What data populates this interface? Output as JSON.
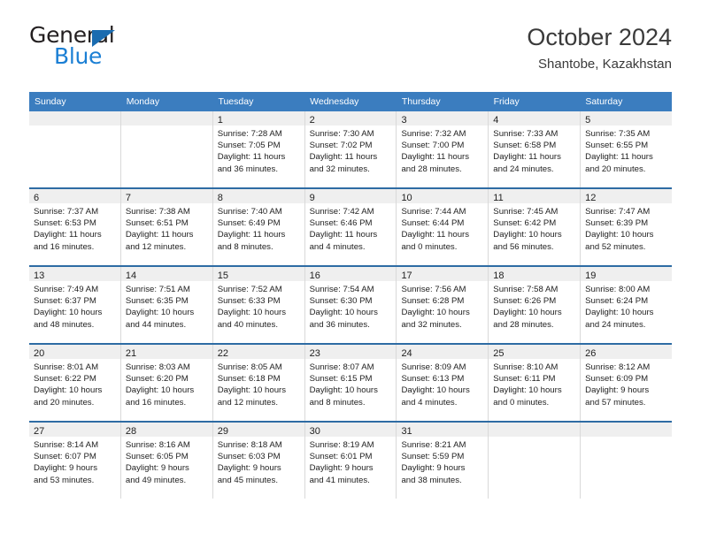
{
  "brand": {
    "name_top": "General",
    "name_bottom": "Blue",
    "accent_color": "#1b7fd4",
    "triangle_color": "#1b6cb0"
  },
  "header": {
    "title": "October 2024",
    "subtitle": "Shantobe, Kazakhstan"
  },
  "calendar": {
    "header_bg": "#3b7dbf",
    "row_divider_color": "#2e6ca4",
    "daynum_band_bg": "#efefef",
    "weekday_headers": [
      "Sunday",
      "Monday",
      "Tuesday",
      "Wednesday",
      "Thursday",
      "Friday",
      "Saturday"
    ],
    "weeks": [
      [
        {
          "day": "",
          "sunrise": "",
          "sunset": "",
          "daylight_1": "",
          "daylight_2": ""
        },
        {
          "day": "",
          "sunrise": "",
          "sunset": "",
          "daylight_1": "",
          "daylight_2": ""
        },
        {
          "day": "1",
          "sunrise": "Sunrise: 7:28 AM",
          "sunset": "Sunset: 7:05 PM",
          "daylight_1": "Daylight: 11 hours",
          "daylight_2": "and 36 minutes."
        },
        {
          "day": "2",
          "sunrise": "Sunrise: 7:30 AM",
          "sunset": "Sunset: 7:02 PM",
          "daylight_1": "Daylight: 11 hours",
          "daylight_2": "and 32 minutes."
        },
        {
          "day": "3",
          "sunrise": "Sunrise: 7:32 AM",
          "sunset": "Sunset: 7:00 PM",
          "daylight_1": "Daylight: 11 hours",
          "daylight_2": "and 28 minutes."
        },
        {
          "day": "4",
          "sunrise": "Sunrise: 7:33 AM",
          "sunset": "Sunset: 6:58 PM",
          "daylight_1": "Daylight: 11 hours",
          "daylight_2": "and 24 minutes."
        },
        {
          "day": "5",
          "sunrise": "Sunrise: 7:35 AM",
          "sunset": "Sunset: 6:55 PM",
          "daylight_1": "Daylight: 11 hours",
          "daylight_2": "and 20 minutes."
        }
      ],
      [
        {
          "day": "6",
          "sunrise": "Sunrise: 7:37 AM",
          "sunset": "Sunset: 6:53 PM",
          "daylight_1": "Daylight: 11 hours",
          "daylight_2": "and 16 minutes."
        },
        {
          "day": "7",
          "sunrise": "Sunrise: 7:38 AM",
          "sunset": "Sunset: 6:51 PM",
          "daylight_1": "Daylight: 11 hours",
          "daylight_2": "and 12 minutes."
        },
        {
          "day": "8",
          "sunrise": "Sunrise: 7:40 AM",
          "sunset": "Sunset: 6:49 PM",
          "daylight_1": "Daylight: 11 hours",
          "daylight_2": "and 8 minutes."
        },
        {
          "day": "9",
          "sunrise": "Sunrise: 7:42 AM",
          "sunset": "Sunset: 6:46 PM",
          "daylight_1": "Daylight: 11 hours",
          "daylight_2": "and 4 minutes."
        },
        {
          "day": "10",
          "sunrise": "Sunrise: 7:44 AM",
          "sunset": "Sunset: 6:44 PM",
          "daylight_1": "Daylight: 11 hours",
          "daylight_2": "and 0 minutes."
        },
        {
          "day": "11",
          "sunrise": "Sunrise: 7:45 AM",
          "sunset": "Sunset: 6:42 PM",
          "daylight_1": "Daylight: 10 hours",
          "daylight_2": "and 56 minutes."
        },
        {
          "day": "12",
          "sunrise": "Sunrise: 7:47 AM",
          "sunset": "Sunset: 6:39 PM",
          "daylight_1": "Daylight: 10 hours",
          "daylight_2": "and 52 minutes."
        }
      ],
      [
        {
          "day": "13",
          "sunrise": "Sunrise: 7:49 AM",
          "sunset": "Sunset: 6:37 PM",
          "daylight_1": "Daylight: 10 hours",
          "daylight_2": "and 48 minutes."
        },
        {
          "day": "14",
          "sunrise": "Sunrise: 7:51 AM",
          "sunset": "Sunset: 6:35 PM",
          "daylight_1": "Daylight: 10 hours",
          "daylight_2": "and 44 minutes."
        },
        {
          "day": "15",
          "sunrise": "Sunrise: 7:52 AM",
          "sunset": "Sunset: 6:33 PM",
          "daylight_1": "Daylight: 10 hours",
          "daylight_2": "and 40 minutes."
        },
        {
          "day": "16",
          "sunrise": "Sunrise: 7:54 AM",
          "sunset": "Sunset: 6:30 PM",
          "daylight_1": "Daylight: 10 hours",
          "daylight_2": "and 36 minutes."
        },
        {
          "day": "17",
          "sunrise": "Sunrise: 7:56 AM",
          "sunset": "Sunset: 6:28 PM",
          "daylight_1": "Daylight: 10 hours",
          "daylight_2": "and 32 minutes."
        },
        {
          "day": "18",
          "sunrise": "Sunrise: 7:58 AM",
          "sunset": "Sunset: 6:26 PM",
          "daylight_1": "Daylight: 10 hours",
          "daylight_2": "and 28 minutes."
        },
        {
          "day": "19",
          "sunrise": "Sunrise: 8:00 AM",
          "sunset": "Sunset: 6:24 PM",
          "daylight_1": "Daylight: 10 hours",
          "daylight_2": "and 24 minutes."
        }
      ],
      [
        {
          "day": "20",
          "sunrise": "Sunrise: 8:01 AM",
          "sunset": "Sunset: 6:22 PM",
          "daylight_1": "Daylight: 10 hours",
          "daylight_2": "and 20 minutes."
        },
        {
          "day": "21",
          "sunrise": "Sunrise: 8:03 AM",
          "sunset": "Sunset: 6:20 PM",
          "daylight_1": "Daylight: 10 hours",
          "daylight_2": "and 16 minutes."
        },
        {
          "day": "22",
          "sunrise": "Sunrise: 8:05 AM",
          "sunset": "Sunset: 6:18 PM",
          "daylight_1": "Daylight: 10 hours",
          "daylight_2": "and 12 minutes."
        },
        {
          "day": "23",
          "sunrise": "Sunrise: 8:07 AM",
          "sunset": "Sunset: 6:15 PM",
          "daylight_1": "Daylight: 10 hours",
          "daylight_2": "and 8 minutes."
        },
        {
          "day": "24",
          "sunrise": "Sunrise: 8:09 AM",
          "sunset": "Sunset: 6:13 PM",
          "daylight_1": "Daylight: 10 hours",
          "daylight_2": "and 4 minutes."
        },
        {
          "day": "25",
          "sunrise": "Sunrise: 8:10 AM",
          "sunset": "Sunset: 6:11 PM",
          "daylight_1": "Daylight: 10 hours",
          "daylight_2": "and 0 minutes."
        },
        {
          "day": "26",
          "sunrise": "Sunrise: 8:12 AM",
          "sunset": "Sunset: 6:09 PM",
          "daylight_1": "Daylight: 9 hours",
          "daylight_2": "and 57 minutes."
        }
      ],
      [
        {
          "day": "27",
          "sunrise": "Sunrise: 8:14 AM",
          "sunset": "Sunset: 6:07 PM",
          "daylight_1": "Daylight: 9 hours",
          "daylight_2": "and 53 minutes."
        },
        {
          "day": "28",
          "sunrise": "Sunrise: 8:16 AM",
          "sunset": "Sunset: 6:05 PM",
          "daylight_1": "Daylight: 9 hours",
          "daylight_2": "and 49 minutes."
        },
        {
          "day": "29",
          "sunrise": "Sunrise: 8:18 AM",
          "sunset": "Sunset: 6:03 PM",
          "daylight_1": "Daylight: 9 hours",
          "daylight_2": "and 45 minutes."
        },
        {
          "day": "30",
          "sunrise": "Sunrise: 8:19 AM",
          "sunset": "Sunset: 6:01 PM",
          "daylight_1": "Daylight: 9 hours",
          "daylight_2": "and 41 minutes."
        },
        {
          "day": "31",
          "sunrise": "Sunrise: 8:21 AM",
          "sunset": "Sunset: 5:59 PM",
          "daylight_1": "Daylight: 9 hours",
          "daylight_2": "and 38 minutes."
        },
        {
          "day": "",
          "sunrise": "",
          "sunset": "",
          "daylight_1": "",
          "daylight_2": ""
        },
        {
          "day": "",
          "sunrise": "",
          "sunset": "",
          "daylight_1": "",
          "daylight_2": ""
        }
      ]
    ]
  }
}
